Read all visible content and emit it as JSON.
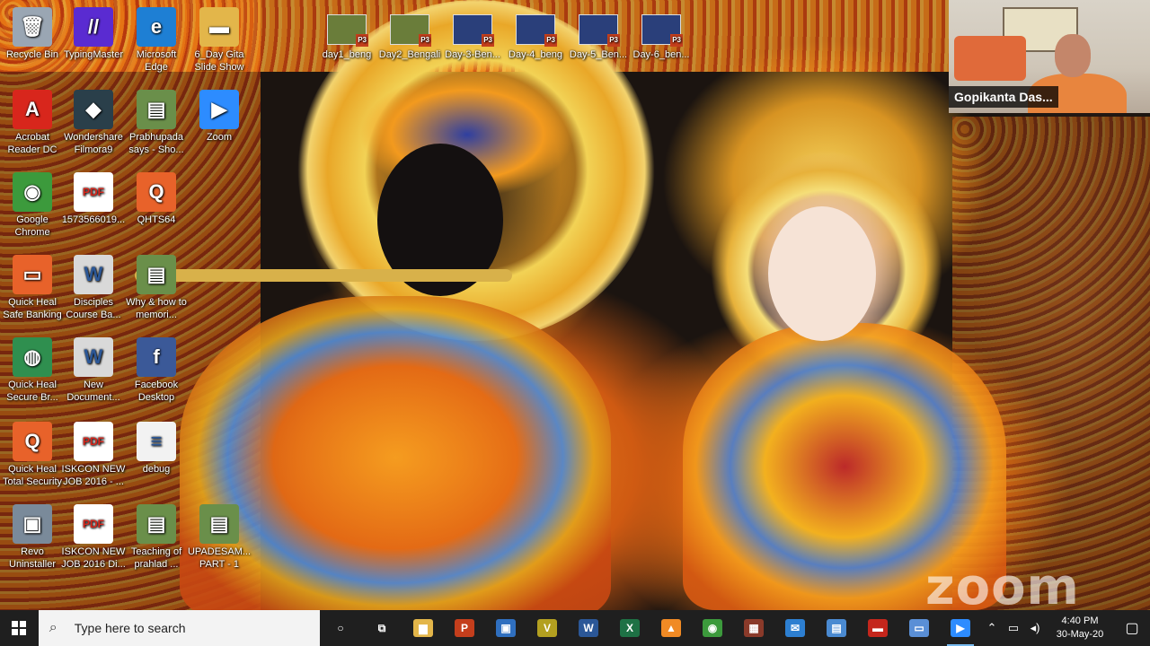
{
  "desktop": {
    "icons": [
      {
        "label": "Recycle Bin",
        "icon": "recycle-bin-icon",
        "color": "#9aa6b3",
        "glyph": "🗑"
      },
      {
        "label": "TypingMaster",
        "icon": "typingmaster-icon",
        "color": "#5a2bd1",
        "glyph": "//"
      },
      {
        "label": "Microsoft Edge",
        "icon": "edge-icon",
        "color": "#1e7fd4",
        "glyph": "e"
      },
      {
        "label": "6_Day Gita Slide Show",
        "icon": "folder-icon",
        "color": "#e3b64a",
        "glyph": "▬"
      },
      {
        "label": "Acrobat Reader DC",
        "icon": "acrobat-icon",
        "color": "#d8261c",
        "glyph": "A"
      },
      {
        "label": "Wondershare Filmora9",
        "icon": "filmora-icon",
        "color": "#2a3f4a",
        "glyph": "◆"
      },
      {
        "label": "Prabhupada says - Sho...",
        "icon": "ppt-file-icon",
        "color": "#6a8f4a",
        "glyph": "▤"
      },
      {
        "label": "Zoom",
        "icon": "zoom-icon",
        "color": "#2d8cff",
        "glyph": "▶"
      },
      {
        "label": "Google Chrome",
        "icon": "chrome-icon",
        "color": "#3c9a3c",
        "glyph": "◉"
      },
      {
        "label": "1573566019...",
        "icon": "pdf-icon",
        "color": "#ffffff",
        "glyph": "PDF"
      },
      {
        "label": "QHTS64",
        "icon": "quickheal-icon",
        "color": "#e8622a",
        "glyph": "Q"
      },
      {
        "label": "Quick Heal Safe Banking",
        "icon": "safe-banking-icon",
        "color": "#e8622a",
        "glyph": "▭"
      },
      {
        "label": "Disciples Course Ba...",
        "icon": "word-file-icon",
        "color": "#d9d9d9",
        "glyph": "W"
      },
      {
        "label": "Why & how to memori...",
        "icon": "ppt-file-icon",
        "color": "#6a8f4a",
        "glyph": "▤"
      },
      {
        "label": "Quick Heal Secure Br...",
        "icon": "secure-browser-icon",
        "color": "#2f8f4f",
        "glyph": "◍"
      },
      {
        "label": "New Document...",
        "icon": "word-file-icon",
        "color": "#d9d9d9",
        "glyph": "W"
      },
      {
        "label": "Facebook Desktop",
        "icon": "facebook-icon",
        "color": "#3b5998",
        "glyph": "f"
      },
      {
        "label": "Quick Heal Total Security",
        "icon": "quickheal-icon",
        "color": "#e8622a",
        "glyph": "Q"
      },
      {
        "label": "ISKCON NEW JOB 2016 - ...",
        "icon": "pdf-icon",
        "color": "#ffffff",
        "glyph": "PDF"
      },
      {
        "label": "debug",
        "icon": "text-file-icon",
        "color": "#f2f2f2",
        "glyph": "≡"
      },
      {
        "label": "Revo Uninstaller",
        "icon": "revo-icon",
        "color": "#7a8a9a",
        "glyph": "▣"
      },
      {
        "label": "ISKCON NEW JOB 2016 Di...",
        "icon": "pdf-icon",
        "color": "#ffffff",
        "glyph": "PDF"
      },
      {
        "label": "Teaching of prahlad ...",
        "icon": "ppt-file-icon",
        "color": "#6a8f4a",
        "glyph": "▤"
      },
      {
        "label": "UPADESAM... PART - 1",
        "icon": "ppt-file-icon",
        "color": "#6a8f4a",
        "glyph": "▤"
      }
    ],
    "ppt_files": [
      {
        "label": "day1_beng",
        "thumb": "#6a7d3a"
      },
      {
        "label": "Day2_Bengali",
        "thumb": "#6a7d3a"
      },
      {
        "label": "Day-3-Ben...",
        "thumb": "#2a3f7a"
      },
      {
        "label": "Day-4_beng",
        "thumb": "#2a3f7a"
      },
      {
        "label": "Day-5_Ben...",
        "thumb": "#2a3f7a"
      },
      {
        "label": "Day-6_ben...",
        "thumb": "#2a3f7a"
      }
    ]
  },
  "zoom": {
    "participant_name": "Gopikanta Das...",
    "watermark": "zoom"
  },
  "taskbar": {
    "search_placeholder": "Type here to search",
    "apps": [
      {
        "name": "cortana-icon",
        "glyph": "○",
        "color": "transparent"
      },
      {
        "name": "task-view-icon",
        "glyph": "⧉",
        "color": "transparent"
      },
      {
        "name": "file-explorer-icon",
        "glyph": "▆",
        "color": "#e3b64a"
      },
      {
        "name": "powerpoint-icon",
        "glyph": "P",
        "color": "#c43e1c"
      },
      {
        "name": "store-icon",
        "glyph": "▣",
        "color": "#2f6fbf"
      },
      {
        "name": "v-app-icon",
        "glyph": "V",
        "color": "#b3a020"
      },
      {
        "name": "word-icon",
        "glyph": "W",
        "color": "#2b5797"
      },
      {
        "name": "excel-icon",
        "glyph": "X",
        "color": "#1e7145"
      },
      {
        "name": "vlc-icon",
        "glyph": "▲",
        "color": "#f08a24"
      },
      {
        "name": "chrome-icon",
        "glyph": "◉",
        "color": "#3c9a3c"
      },
      {
        "name": "media-app-icon",
        "glyph": "▦",
        "color": "#8a3a2a"
      },
      {
        "name": "mail-icon",
        "glyph": "✉",
        "color": "#2d7fd1"
      },
      {
        "name": "control-panel-icon",
        "glyph": "▤",
        "color": "#4a8ad1"
      },
      {
        "name": "red-app-icon",
        "glyph": "▬",
        "color": "#c4261c"
      },
      {
        "name": "monitor-app-icon",
        "glyph": "▭",
        "color": "#5a8fd6"
      },
      {
        "name": "zoom-icon",
        "glyph": "▶",
        "color": "#2d8cff"
      }
    ],
    "time": "4:40 PM",
    "date": "30-May-20"
  }
}
